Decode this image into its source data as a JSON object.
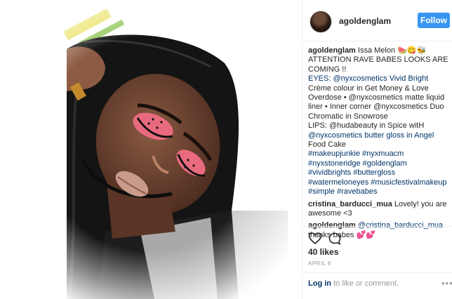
{
  "post": {
    "username": "agoldenglam",
    "follow_label": "Follow",
    "caption_lines": [
      "Issa Melon 🍉😋🐝",
      "ATTENTION RAVE BABES LOOKS ARE",
      "COMING !!",
      "EYES: @nyxcosmetics Vivid Bright",
      "Crème colour in Get Money & Love",
      "Overdose • @nyxcosmetics matte liquid",
      "liner • Inner corner @nyxcosmetics Duo",
      "Chromatic in Snowrose",
      "LIPS: @hudabeauty in Spice witH",
      "@nyxcosmetics butter gloss in Angel",
      "Food Cake",
      "#makeupjunkie #nyxmuacm",
      "#nyxstoneridge #goldenglam",
      "#vividbrights #buttergloss",
      "#watermeloneyes #musicfestivalmakeup",
      "#simple #ravebabes"
    ],
    "comments": [
      {
        "username": "cristina_barducci_mua",
        "text": "Lovely! you are awesome <3"
      },
      {
        "username": "agoldenglam",
        "mention": "@cristina_barducci_mua",
        "text": "thanks babes 💕💕"
      }
    ],
    "likes": "40 likes",
    "date": "APRIL 6",
    "login_link": "Log in",
    "login_rest": "to like or comment.",
    "more_label": "•••",
    "icons": {
      "like": "heart-icon",
      "comment": "comment-icon",
      "more": "more-options-icon"
    },
    "colors": {
      "follow_button": "#3897f0",
      "link": "#003569",
      "muted": "#999999"
    }
  }
}
